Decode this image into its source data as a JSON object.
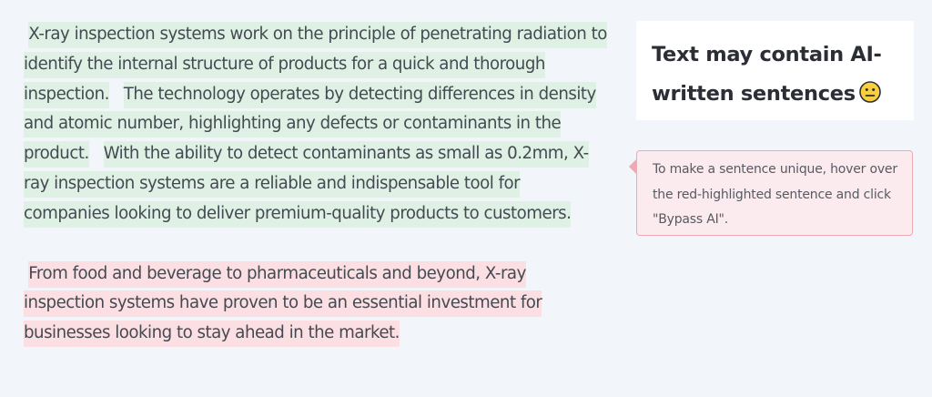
{
  "article": {
    "paragraphs": [
      {
        "sentences": [
          {
            "text": "X-ray inspection systems work on the principle of penetrating radiation to identify the internal structure of products for a quick and thorough inspection.",
            "status": "human"
          },
          {
            "text": "The technology operates by detecting differences in density and atomic number, highlighting any defects or contaminants in the product.",
            "status": "human"
          },
          {
            "text": "With the ability to detect contaminants as small as 0.2mm, X-ray inspection systems are a reliable and indispensable tool for companies looking to deliver premium-quality products to customers.",
            "status": "human"
          }
        ]
      },
      {
        "sentences": [
          {
            "text": "From food and beverage to pharmaceuticals and beyond, X-ray inspection systems have proven to be an essential investment for businesses looking to stay ahead in the market.",
            "status": "ai"
          }
        ]
      }
    ]
  },
  "verdict": {
    "title": "Text may contain AI-written sentences",
    "emoji_icon": "neutral-face-icon"
  },
  "hint": {
    "text": "To make a sentence unique, hover over the red-highlighted sentence and click \"Bypass AI\"."
  },
  "colors": {
    "page_background": "#f2f6fa",
    "human_highlight": "#dff0e4",
    "ai_highlight": "#fbdfe3",
    "hint_background": "#fcebee",
    "hint_border": "#f0a9b3",
    "emoji_fill": "#f7cf3f"
  }
}
